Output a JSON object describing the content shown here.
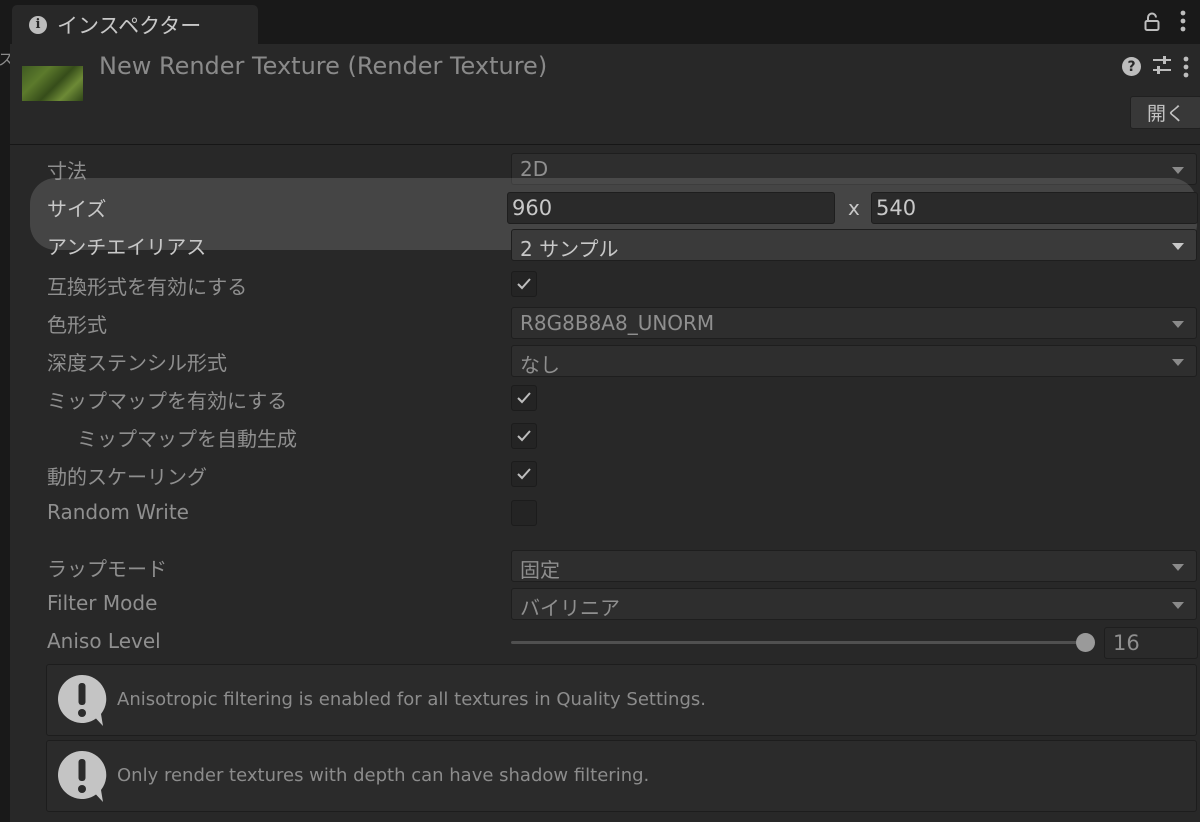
{
  "window": {
    "tab_label": "インスペクター",
    "left_edge_glyph": "ス"
  },
  "header": {
    "asset_title": "New Render Texture (Render Texture)",
    "help_icon_glyph": "?",
    "open_button_label": "開く"
  },
  "properties": {
    "dimension": {
      "label": "寸法",
      "value": "2D"
    },
    "size": {
      "label": "サイズ",
      "width": "960",
      "separator": "x",
      "height": "540"
    },
    "anti_aliasing": {
      "label": "アンチエイリアス",
      "value": "2 サンプル"
    },
    "enable_compatible_format": {
      "label": "互換形式を有効にする",
      "checked": true
    },
    "color_format": {
      "label": "色形式",
      "value": "R8G8B8A8_UNORM"
    },
    "depth_stencil_format": {
      "label": "深度ステンシル形式",
      "value": "なし"
    },
    "enable_mip_maps": {
      "label": "ミップマップを有効にする",
      "checked": true
    },
    "auto_generate_mip_maps": {
      "label": "ミップマップを自動生成",
      "checked": true
    },
    "dynamic_scaling": {
      "label": "動的スケーリング",
      "checked": true
    },
    "random_write": {
      "label": "Random Write",
      "checked": false
    },
    "wrap_mode": {
      "label": "ラップモード",
      "value": "固定"
    },
    "filter_mode": {
      "label": "Filter Mode",
      "value": "バイリニア"
    },
    "aniso_level": {
      "label": "Aniso Level",
      "value": "16",
      "slider_fraction": 1.0
    }
  },
  "help_messages": [
    {
      "text": "Anisotropic filtering is enabled for all textures in Quality Settings."
    },
    {
      "text": "Only render textures with depth can have shadow filtering."
    }
  ],
  "icons": {
    "tab": "info-icon",
    "lock": "lock-icon",
    "menu": "kebab-menu-icon",
    "help": "help-icon",
    "presets": "preset-sliders-icon",
    "warning": "warning-icon",
    "check": "checkmark-icon"
  },
  "colors": {
    "panel_bg": "#282828",
    "window_bg": "#1c1c1c",
    "text_dim": "#8f8f8f",
    "text_bright": "#c8c8c8"
  }
}
